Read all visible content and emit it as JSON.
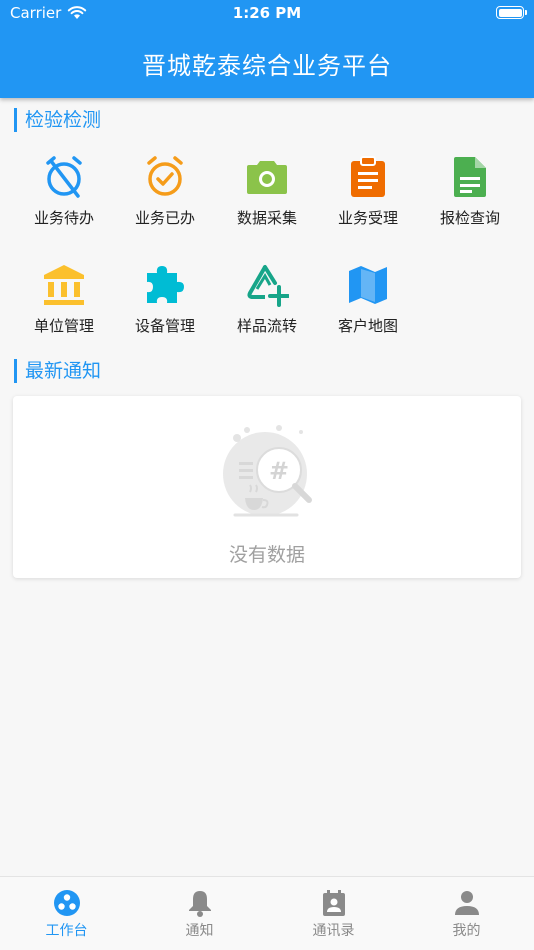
{
  "status_bar": {
    "carrier": "Carrier",
    "time": "1:26 PM"
  },
  "header": {
    "title": "晋城乾泰综合业务平台"
  },
  "sections": {
    "inspection": {
      "title": "检验检测"
    },
    "notices": {
      "title": "最新通知"
    }
  },
  "grid": [
    {
      "label": "业务待办",
      "icon": "alarm-off-icon",
      "color": "#2196f3"
    },
    {
      "label": "业务已办",
      "icon": "alarm-check-icon",
      "color": "#f59c1a"
    },
    {
      "label": "数据采集",
      "icon": "camera-icon",
      "color": "#8bc34a"
    },
    {
      "label": "业务受理",
      "icon": "clipboard-icon",
      "color": "#ef6c00"
    },
    {
      "label": "报检查询",
      "icon": "document-icon",
      "color": "#4caf50"
    },
    {
      "label": "单位管理",
      "icon": "bank-icon",
      "color": "#fbc02d"
    },
    {
      "label": "设备管理",
      "icon": "puzzle-icon",
      "color": "#00bcd4"
    },
    {
      "label": "样品流转",
      "icon": "recycle-add-icon",
      "color": "#17a589"
    },
    {
      "label": "客户地图",
      "icon": "map-icon",
      "color": "#2196f3"
    }
  ],
  "notices": {
    "empty_text": "没有数据"
  },
  "bottom_nav": [
    {
      "label": "工作台",
      "icon": "workbench-icon",
      "active": true
    },
    {
      "label": "通知",
      "icon": "bell-icon",
      "active": false
    },
    {
      "label": "通讯录",
      "icon": "contacts-icon",
      "active": false
    },
    {
      "label": "我的",
      "icon": "person-icon",
      "active": false
    }
  ],
  "colors": {
    "primary": "#2196f3",
    "inactive": "#8a8a8a"
  }
}
